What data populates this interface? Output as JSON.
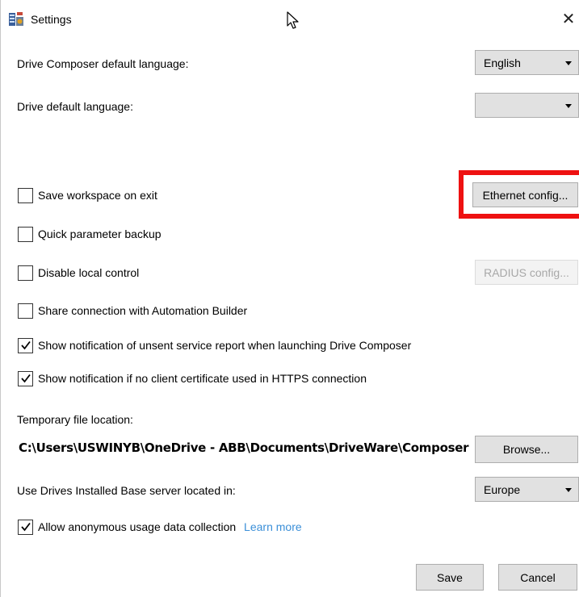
{
  "window": {
    "title": "Settings",
    "close_glyph": "✕",
    "app_icon": "settings-app-icon"
  },
  "language": {
    "composer_label": "Drive Composer default language:",
    "composer_value": "English",
    "drive_label": "Drive default language:",
    "drive_value": ""
  },
  "options": {
    "save_workspace": {
      "label": "Save workspace on exit",
      "checked": false
    },
    "quick_backup": {
      "label": "Quick parameter backup",
      "checked": false
    },
    "disable_local": {
      "label": "Disable local control",
      "checked": false
    },
    "share_connection": {
      "label": "Share connection with Automation Builder",
      "checked": false
    },
    "notify_service": {
      "label": "Show notification of unsent service report when launching Drive Composer",
      "checked": true
    },
    "notify_cert": {
      "label": "Show notification if no client certificate used in HTTPS connection",
      "checked": true
    }
  },
  "buttons": {
    "ethernet_config": "Ethernet config...",
    "radius_config": "RADIUS config...",
    "browse": "Browse...",
    "save": "Save",
    "cancel": "Cancel"
  },
  "temp": {
    "label": "Temporary file location:",
    "path": "C:\\Users\\USWINYB\\OneDrive - ABB\\Documents\\DriveWare\\Composer"
  },
  "server": {
    "label": "Use Drives Installed Base server located in:",
    "value": "Europe"
  },
  "usage": {
    "label": "Allow anonymous usage data collection",
    "checked": true,
    "learn_more": "Learn more"
  },
  "colors": {
    "highlight": "#ee1111",
    "link": "#3b8fd8",
    "button_bg": "#e1e1e1"
  }
}
